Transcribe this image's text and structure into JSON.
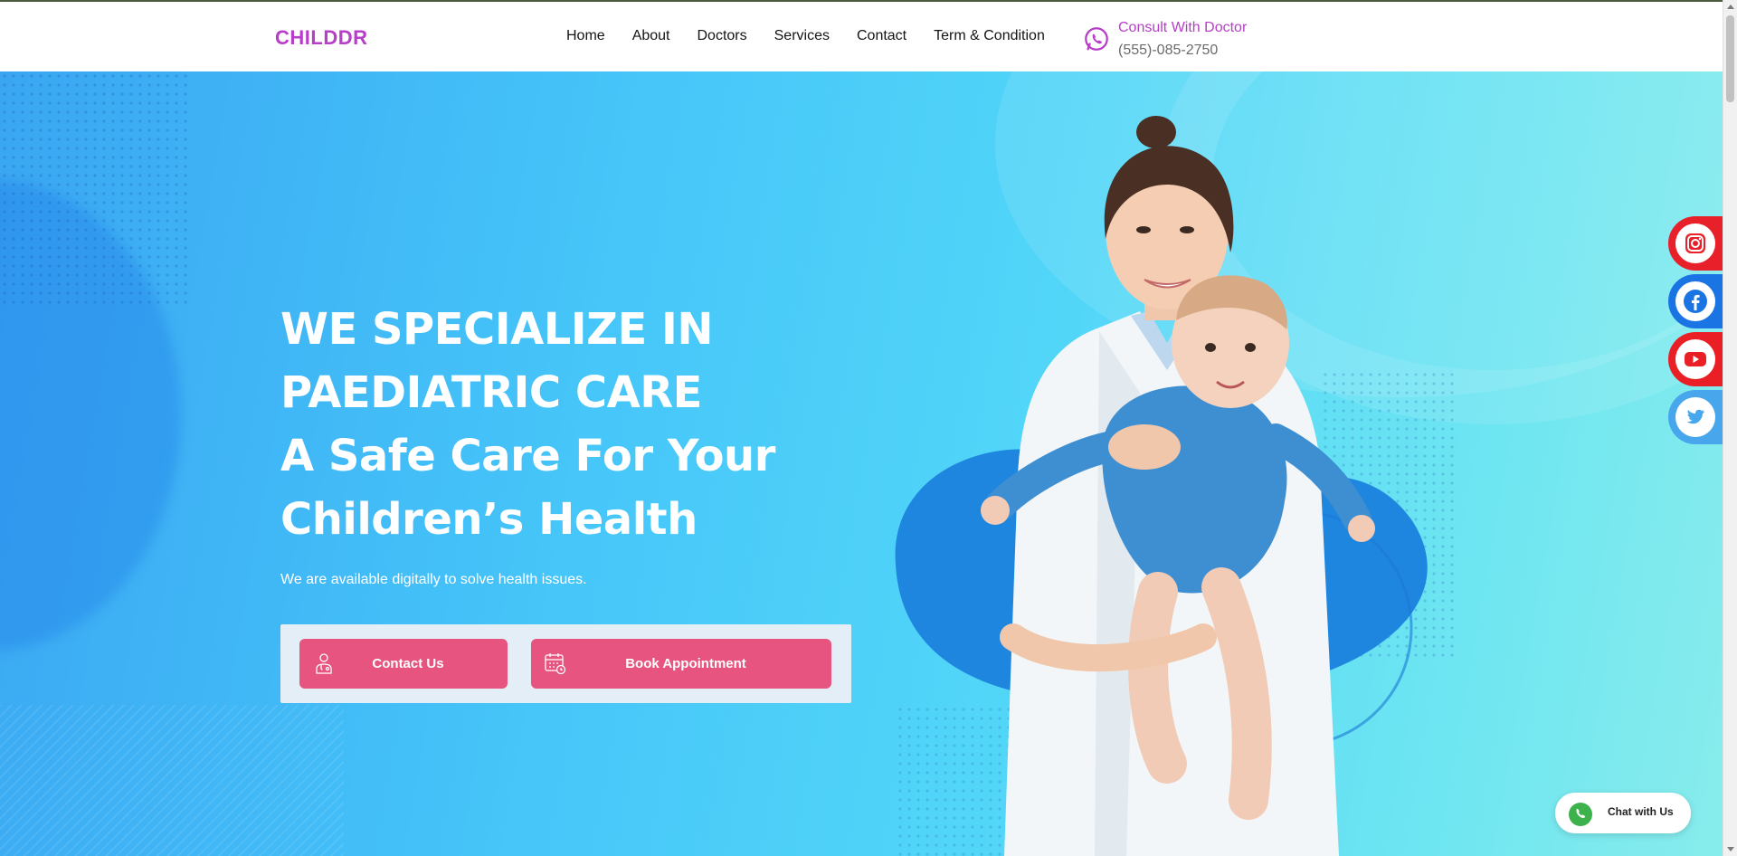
{
  "brand": {
    "name": "CHILDDR",
    "accent": "#b73ec8"
  },
  "nav": {
    "items": [
      "Home",
      "About",
      "Doctors",
      "Services",
      "Contact",
      "Term & Condition"
    ]
  },
  "consult": {
    "title": "Consult With Doctor",
    "phone": "(555)-085-2750",
    "icon": "whatsapp-icon"
  },
  "hero": {
    "heading_lines": [
      "WE SPECIALIZE IN",
      "PAEDIATRIC CARE",
      "A Safe Care For Your",
      "Children’s Health"
    ],
    "subtitle": "We are available digitally to solve health issues.",
    "buttons": [
      {
        "label": "Contact Us",
        "icon": "doctor-icon"
      },
      {
        "label": "Book Appointment",
        "icon": "calendar-icon"
      }
    ],
    "button_color": "#e75480",
    "image": "doctor-holding-baby"
  },
  "social": [
    {
      "name": "instagram",
      "icon": "instagram-icon",
      "color": "#e8202a"
    },
    {
      "name": "facebook",
      "icon": "facebook-icon",
      "color": "#1b74e4"
    },
    {
      "name": "youtube",
      "icon": "youtube-icon",
      "color": "#ea1f25"
    },
    {
      "name": "twitter",
      "icon": "twitter-icon",
      "color": "#48a6ec"
    }
  ],
  "chat": {
    "label": "Chat with Us",
    "icon": "whatsapp-icon"
  }
}
